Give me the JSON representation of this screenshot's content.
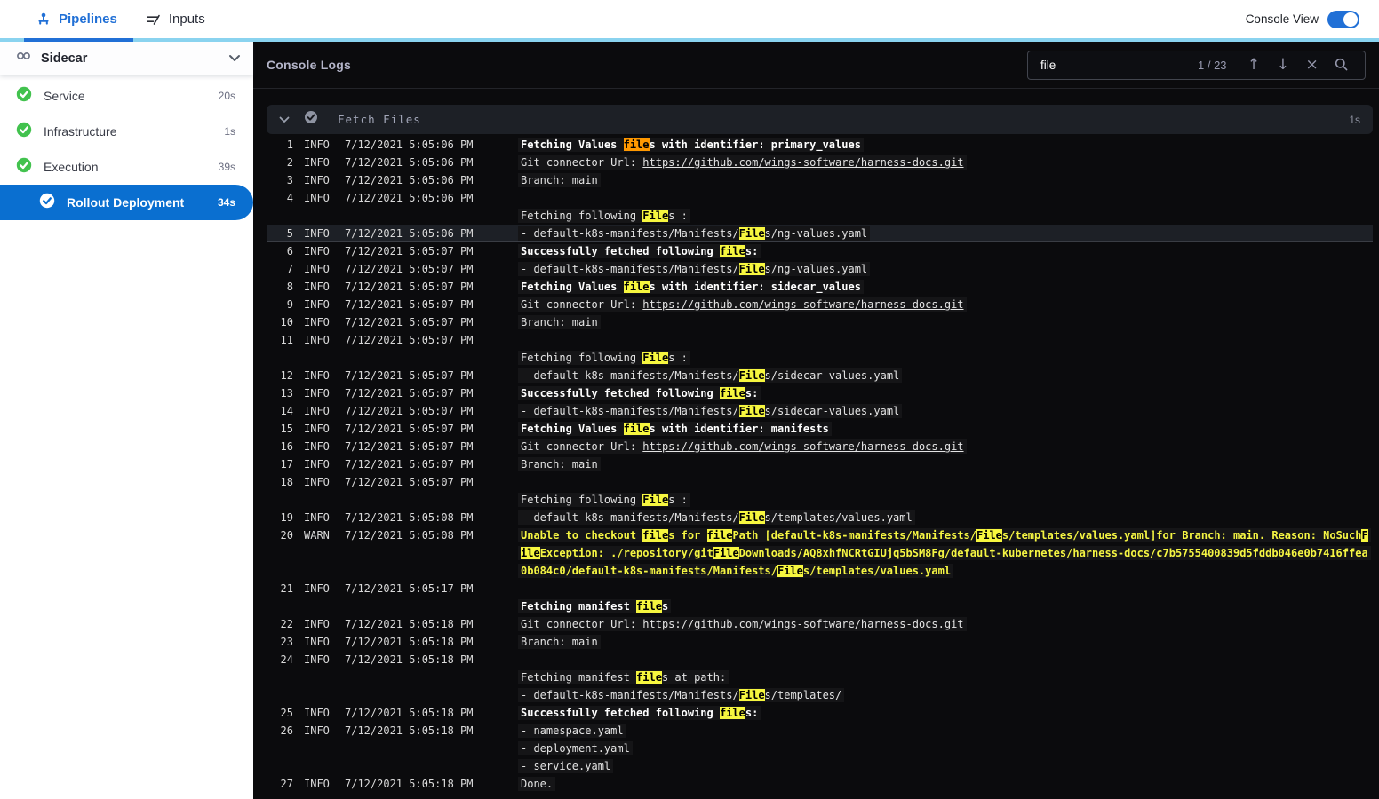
{
  "colors": {
    "accent_blue": "#0a6fd0",
    "tab_blue": "#2170d6",
    "topbar_border_cyan": "#8ad3ef",
    "success_green": "#42c24e",
    "console_bg": "#0b0b0d",
    "section_bg": "#1d2026",
    "match_yellow": "#f6f63f",
    "active_match_orange": "#ff9800",
    "warn_yellow": "#f5f543",
    "selected_row_bg": "#1d2026"
  },
  "topbar": {
    "tabs": [
      {
        "label": "Pipelines",
        "active": true
      },
      {
        "label": "Inputs",
        "active": false
      }
    ],
    "console_view_label": "Console View",
    "console_view_on": true
  },
  "sidebar": {
    "header": {
      "label": "Sidecar"
    },
    "items": [
      {
        "label": "Service",
        "duration": "20s",
        "selected": false
      },
      {
        "label": "Infrastructure",
        "duration": "1s",
        "selected": false
      },
      {
        "label": "Execution",
        "duration": "39s",
        "selected": false
      },
      {
        "label": "Rollout Deployment",
        "duration": "34s",
        "selected": true
      }
    ]
  },
  "console": {
    "title": "Console Logs",
    "search": {
      "value": "file",
      "counter": "1 / 23"
    },
    "section": {
      "title": "Fetch Files",
      "duration": "1s"
    },
    "logs": [
      {
        "num": "1",
        "level": "INFO",
        "time": "7/12/2021 5:05:06 PM",
        "lines": [
          [
            {
              "t": "Fetching Values ",
              "b": 1
            },
            {
              "t": "file",
              "b": 1,
              "hl": "o"
            },
            {
              "t": "s with identifier: primary_values",
              "b": 1
            }
          ]
        ]
      },
      {
        "num": "2",
        "level": "INFO",
        "time": "7/12/2021 5:05:06 PM",
        "lines": [
          [
            {
              "t": "Git connector Url: "
            },
            {
              "t": "https://github.com/wings-software/harness-docs.git",
              "link": 1
            }
          ]
        ]
      },
      {
        "num": "3",
        "level": "INFO",
        "time": "7/12/2021 5:05:06 PM",
        "lines": [
          [
            {
              "t": "Branch: main"
            }
          ]
        ]
      },
      {
        "num": "4",
        "level": "INFO",
        "time": "7/12/2021 5:05:06 PM",
        "lines": [
          [],
          [
            {
              "t": "Fetching following "
            },
            {
              "t": "File",
              "hl": "y"
            },
            {
              "t": "s :"
            }
          ]
        ]
      },
      {
        "num": "5",
        "level": "INFO",
        "time": "7/12/2021 5:05:06 PM",
        "sel": true,
        "lines": [
          [
            {
              "t": "- default-k8s-manifests/Manifests/"
            },
            {
              "t": "File",
              "hl": "y"
            },
            {
              "t": "s/ng-values.yaml"
            }
          ]
        ]
      },
      {
        "num": "6",
        "level": "INFO",
        "time": "7/12/2021 5:05:07 PM",
        "lines": [
          [
            {
              "t": "Successfully fetched following ",
              "b": 1
            },
            {
              "t": "file",
              "b": 1,
              "hl": "y"
            },
            {
              "t": "s:",
              "b": 1
            }
          ]
        ]
      },
      {
        "num": "7",
        "level": "INFO",
        "time": "7/12/2021 5:05:07 PM",
        "lines": [
          [
            {
              "t": "- default-k8s-manifests/Manifests/"
            },
            {
              "t": "File",
              "hl": "y"
            },
            {
              "t": "s/ng-values.yaml"
            }
          ]
        ]
      },
      {
        "num": "8",
        "level": "INFO",
        "time": "7/12/2021 5:05:07 PM",
        "lines": [
          [
            {
              "t": "Fetching Values ",
              "b": 1
            },
            {
              "t": "file",
              "b": 1,
              "hl": "y"
            },
            {
              "t": "s with identifier: sidecar_values",
              "b": 1
            }
          ]
        ]
      },
      {
        "num": "9",
        "level": "INFO",
        "time": "7/12/2021 5:05:07 PM",
        "lines": [
          [
            {
              "t": "Git connector Url: "
            },
            {
              "t": "https://github.com/wings-software/harness-docs.git",
              "link": 1
            }
          ]
        ]
      },
      {
        "num": "10",
        "level": "INFO",
        "time": "7/12/2021 5:05:07 PM",
        "lines": [
          [
            {
              "t": "Branch: main"
            }
          ]
        ]
      },
      {
        "num": "11",
        "level": "INFO",
        "time": "7/12/2021 5:05:07 PM",
        "lines": [
          [],
          [
            {
              "t": "Fetching following "
            },
            {
              "t": "File",
              "hl": "y"
            },
            {
              "t": "s :"
            }
          ]
        ]
      },
      {
        "num": "12",
        "level": "INFO",
        "time": "7/12/2021 5:05:07 PM",
        "lines": [
          [
            {
              "t": "- default-k8s-manifests/Manifests/"
            },
            {
              "t": "File",
              "hl": "y"
            },
            {
              "t": "s/sidecar-values.yaml"
            }
          ]
        ]
      },
      {
        "num": "13",
        "level": "INFO",
        "time": "7/12/2021 5:05:07 PM",
        "lines": [
          [
            {
              "t": "Successfully fetched following ",
              "b": 1
            },
            {
              "t": "file",
              "b": 1,
              "hl": "y"
            },
            {
              "t": "s:",
              "b": 1
            }
          ]
        ]
      },
      {
        "num": "14",
        "level": "INFO",
        "time": "7/12/2021 5:05:07 PM",
        "lines": [
          [
            {
              "t": "- default-k8s-manifests/Manifests/"
            },
            {
              "t": "File",
              "hl": "y"
            },
            {
              "t": "s/sidecar-values.yaml"
            }
          ]
        ]
      },
      {
        "num": "15",
        "level": "INFO",
        "time": "7/12/2021 5:05:07 PM",
        "lines": [
          [
            {
              "t": "Fetching Values ",
              "b": 1
            },
            {
              "t": "file",
              "b": 1,
              "hl": "y"
            },
            {
              "t": "s with identifier: manifests",
              "b": 1
            }
          ]
        ]
      },
      {
        "num": "16",
        "level": "INFO",
        "time": "7/12/2021 5:05:07 PM",
        "lines": [
          [
            {
              "t": "Git connector Url: "
            },
            {
              "t": "https://github.com/wings-software/harness-docs.git",
              "link": 1
            }
          ]
        ]
      },
      {
        "num": "17",
        "level": "INFO",
        "time": "7/12/2021 5:05:07 PM",
        "lines": [
          [
            {
              "t": "Branch: main"
            }
          ]
        ]
      },
      {
        "num": "18",
        "level": "INFO",
        "time": "7/12/2021 5:05:07 PM",
        "lines": [
          [],
          [
            {
              "t": "Fetching following "
            },
            {
              "t": "File",
              "hl": "y"
            },
            {
              "t": "s :"
            }
          ]
        ]
      },
      {
        "num": "19",
        "level": "INFO",
        "time": "7/12/2021 5:05:08 PM",
        "lines": [
          [
            {
              "t": "- default-k8s-manifests/Manifests/"
            },
            {
              "t": "File",
              "hl": "y"
            },
            {
              "t": "s/templates/values.yaml"
            }
          ]
        ]
      },
      {
        "num": "20",
        "level": "WARN",
        "time": "7/12/2021 5:05:08 PM",
        "lines": [
          [
            {
              "t": "Unable to checkout ",
              "w": 1
            },
            {
              "t": "file",
              "hl": "y"
            },
            {
              "t": "s for ",
              "w": 1
            },
            {
              "t": "file",
              "hl": "y"
            },
            {
              "t": "Path [default-k8s-manifests/Manifests/",
              "w": 1
            },
            {
              "t": "File",
              "hl": "y"
            },
            {
              "t": "s/templates/values.yaml]for Branch: main. Reason: NoSuch",
              "w": 1
            },
            {
              "t": "F",
              "hl": "y"
            }
          ],
          [
            {
              "t": "ile",
              "hl": "y"
            },
            {
              "t": "Exception: ./repository/git",
              "w": 1
            },
            {
              "t": "File",
              "hl": "y"
            },
            {
              "t": "Downloads/AQ8xhfNCRtGIUjq5bSM8Fg/default-kubernetes/harness-docs/c7b5755400839d5fddb046e0b7416ffea",
              "w": 1
            }
          ],
          [
            {
              "t": "0b084c0/default-k8s-manifests/Manifests/",
              "w": 1
            },
            {
              "t": "File",
              "hl": "y"
            },
            {
              "t": "s/templates/values.yaml",
              "w": 1
            }
          ]
        ]
      },
      {
        "num": "21",
        "level": "INFO",
        "time": "7/12/2021 5:05:17 PM",
        "lines": [
          [],
          [
            {
              "t": "Fetching manifest ",
              "b": 1
            },
            {
              "t": "file",
              "b": 1,
              "hl": "y"
            },
            {
              "t": "s",
              "b": 1
            }
          ]
        ]
      },
      {
        "num": "22",
        "level": "INFO",
        "time": "7/12/2021 5:05:18 PM",
        "lines": [
          [
            {
              "t": "Git connector Url: "
            },
            {
              "t": "https://github.com/wings-software/harness-docs.git",
              "link": 1
            }
          ]
        ]
      },
      {
        "num": "23",
        "level": "INFO",
        "time": "7/12/2021 5:05:18 PM",
        "lines": [
          [
            {
              "t": "Branch: main"
            }
          ]
        ]
      },
      {
        "num": "24",
        "level": "INFO",
        "time": "7/12/2021 5:05:18 PM",
        "lines": [
          [],
          [
            {
              "t": "Fetching manifest "
            },
            {
              "t": "file",
              "hl": "y"
            },
            {
              "t": "s at path:"
            }
          ],
          [
            {
              "t": "- default-k8s-manifests/Manifests/"
            },
            {
              "t": "File",
              "hl": "y"
            },
            {
              "t": "s/templates/"
            }
          ]
        ]
      },
      {
        "num": "25",
        "level": "INFO",
        "time": "7/12/2021 5:05:18 PM",
        "lines": [
          [
            {
              "t": "Successfully fetched following ",
              "b": 1
            },
            {
              "t": "file",
              "b": 1,
              "hl": "y"
            },
            {
              "t": "s:",
              "b": 1
            }
          ]
        ]
      },
      {
        "num": "26",
        "level": "INFO",
        "time": "7/12/2021 5:05:18 PM",
        "lines": [
          [
            {
              "t": "- namespace.yaml"
            }
          ],
          [
            {
              "t": "- deployment.yaml"
            }
          ],
          [
            {
              "t": "- service.yaml"
            }
          ]
        ]
      },
      {
        "num": "27",
        "level": "INFO",
        "time": "7/12/2021 5:05:18 PM",
        "lines": [
          [
            {
              "t": "Done."
            }
          ]
        ]
      }
    ]
  }
}
